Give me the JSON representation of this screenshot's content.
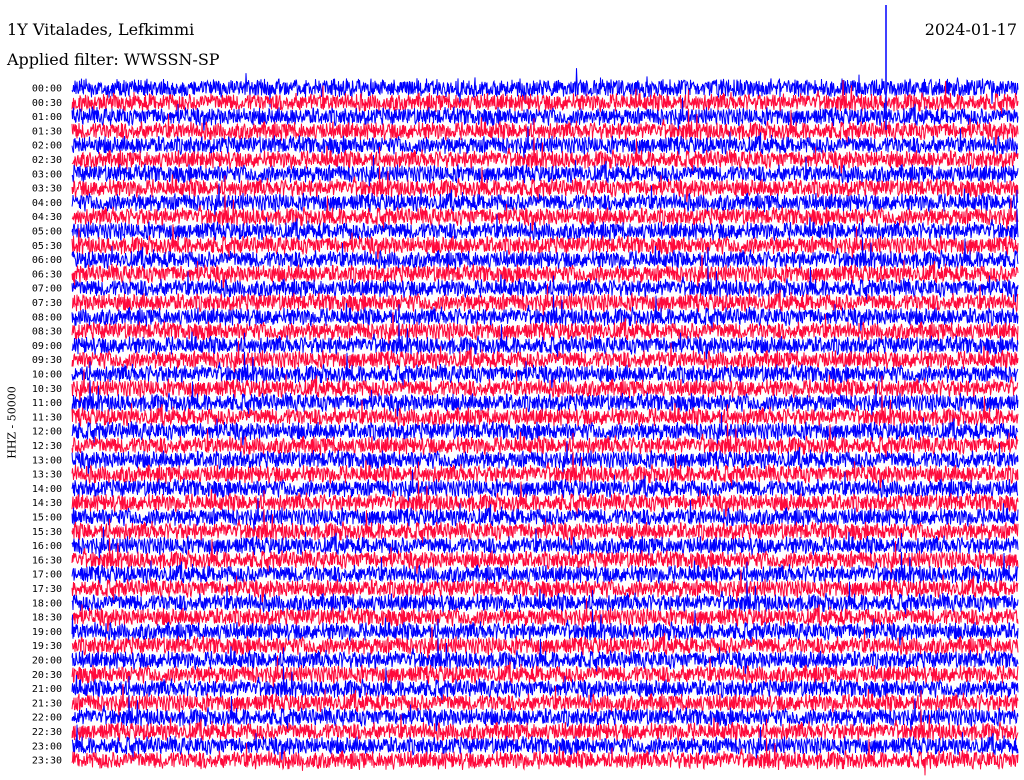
{
  "header": {
    "station": "1Y Vitalades, Lefkimmi",
    "filter": "Applied filter: WWSSN-SP",
    "date": "2024-01-17"
  },
  "chart_data": {
    "type": "line",
    "title": "1Y Vitalades, Lefkimmi",
    "subtitle": "Applied filter: WWSSN-SP",
    "ylabel": "HHZ - 50000",
    "xlabel": "",
    "row_labels": [
      "00:00",
      "00:30",
      "01:00",
      "01:30",
      "02:00",
      "02:30",
      "03:00",
      "03:30",
      "04:00",
      "04:30",
      "05:00",
      "05:30",
      "06:00",
      "06:30",
      "07:00",
      "07:30",
      "08:00",
      "08:30",
      "09:00",
      "09:30",
      "10:00",
      "10:30",
      "11:00",
      "11:30",
      "12:00",
      "12:30",
      "13:00",
      "13:30",
      "14:00",
      "14:30",
      "15:00",
      "15:30",
      "16:00",
      "16:30",
      "17:00",
      "17:30",
      "18:00",
      "18:30",
      "19:00",
      "19:30",
      "20:00",
      "20:30",
      "21:00",
      "21:30",
      "22:00",
      "22:30",
      "23:00",
      "23:30"
    ],
    "series_colors": [
      "#0000ff",
      "#ff0a3c"
    ],
    "grid": false
  }
}
